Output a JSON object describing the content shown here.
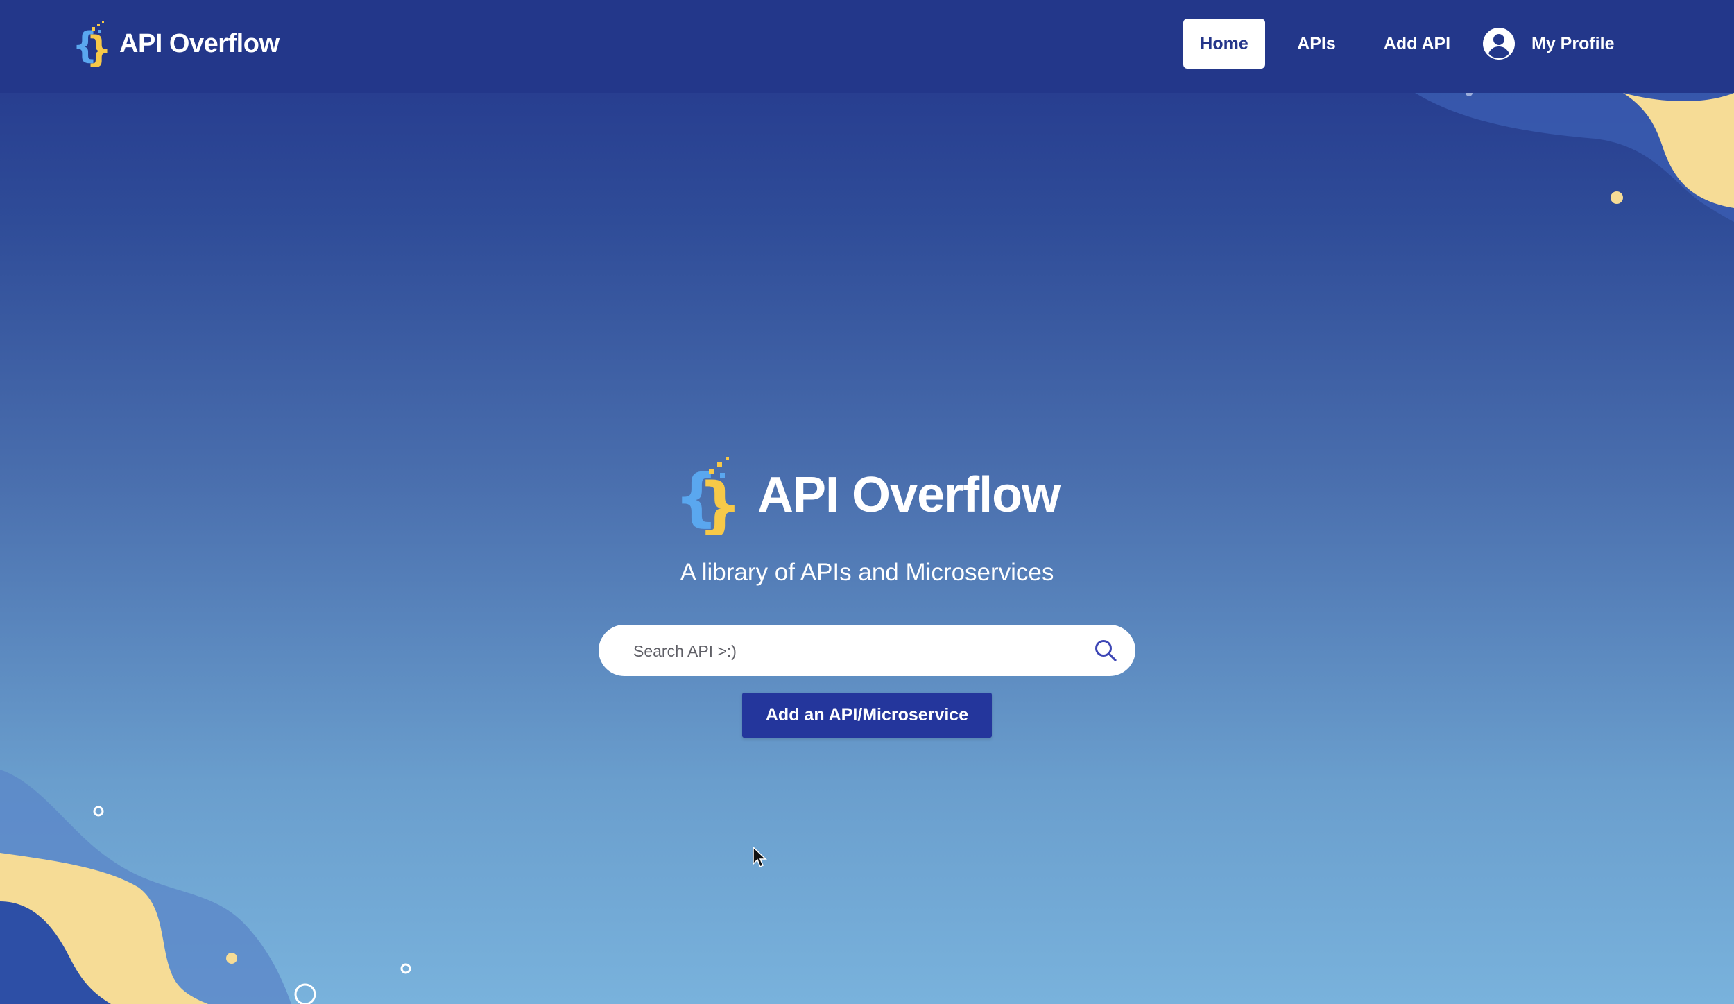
{
  "app": {
    "name": "API Overflow"
  },
  "nav": {
    "items": [
      {
        "label": "Home",
        "active": true
      },
      {
        "label": "APIs",
        "active": false
      },
      {
        "label": "Add API",
        "active": false
      },
      {
        "label": "My Profile",
        "active": false,
        "icon": "user-circle-icon"
      }
    ]
  },
  "hero": {
    "title": "API Overflow",
    "subtitle": "A library of APIs and Microservices",
    "search": {
      "placeholder": "Search API >:)",
      "value": "",
      "icon": "search-icon"
    },
    "cta_label": "Add an API/Microservice"
  },
  "colors": {
    "header_bg": "#23378a",
    "accent_yellow": "#f6dc96",
    "button_blue": "#24369c",
    "logo_blue": "#5aa7ef",
    "logo_yellow": "#f7c948"
  }
}
